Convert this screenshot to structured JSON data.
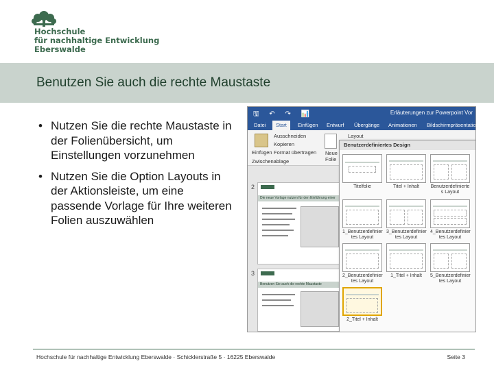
{
  "logo": {
    "line1": "Hochschule",
    "line2": "für nachhaltige Entwicklung",
    "line3": "Eberswalde",
    "icon": "tree-icon",
    "color": "#3d6b4f"
  },
  "slide": {
    "title": "Benutzen Sie auch die rechte Maustaste",
    "bullets": [
      "Nutzen Sie die rechte Maustaste in der Folienübersicht, um Einstellungen vorzunehmen",
      "Nutzen Sie die Option Layouts in der Aktionsleiste, um eine passende Vorlage für Ihre weiteren Folien auszuwählen"
    ],
    "bullet_char": "•"
  },
  "screenshot": {
    "window_title": "Erläuterungen zur Powerpoint Vor",
    "qat_icons": "🖫 ↶ ↷ 📊",
    "tabs": [
      "Datei",
      "Start",
      "Einfügen",
      "Entwurf",
      "Übergänge",
      "Animationen",
      "Bildschirmpräsentation"
    ],
    "active_tab": "Start",
    "ribbon": {
      "paste": "Einfügen",
      "cut": "Ausschneiden",
      "copy": "Kopieren",
      "format": "Format übertragen",
      "clipboard": "Zwischenablage",
      "new_slide_1": "Neue",
      "new_slide_2": "Folie",
      "layout": "Layout"
    },
    "thumb_numbers": [
      "2",
      "3"
    ],
    "thumb_titles": [
      "Die neue Vorlage nutzen für den Einführung einer",
      "Benutzen Sie auch die rechte Maustaste"
    ],
    "gallery": {
      "header": "Benutzerdefiniertes Design",
      "layouts": [
        "Titelfolie",
        "Titel + Inhalt",
        "Benutzerdefinierte s Layout",
        "1_Benutzerdefinier tes Layout",
        "3_Benutzerdefinier tes Layout",
        "4_Benutzerdefinier tes Layout",
        "2_Benutzerdefinier tes Layout",
        "1_Titel + Inhalt",
        "5_Benutzerdefinier tes Layout",
        "2_Titel + Inhalt"
      ]
    }
  },
  "footer": {
    "left": "Hochschule für nachhaltige Entwicklung Eberswalde · Schicklerstraße 5 · 16225 Eberswalde",
    "right": "Seite 3"
  }
}
